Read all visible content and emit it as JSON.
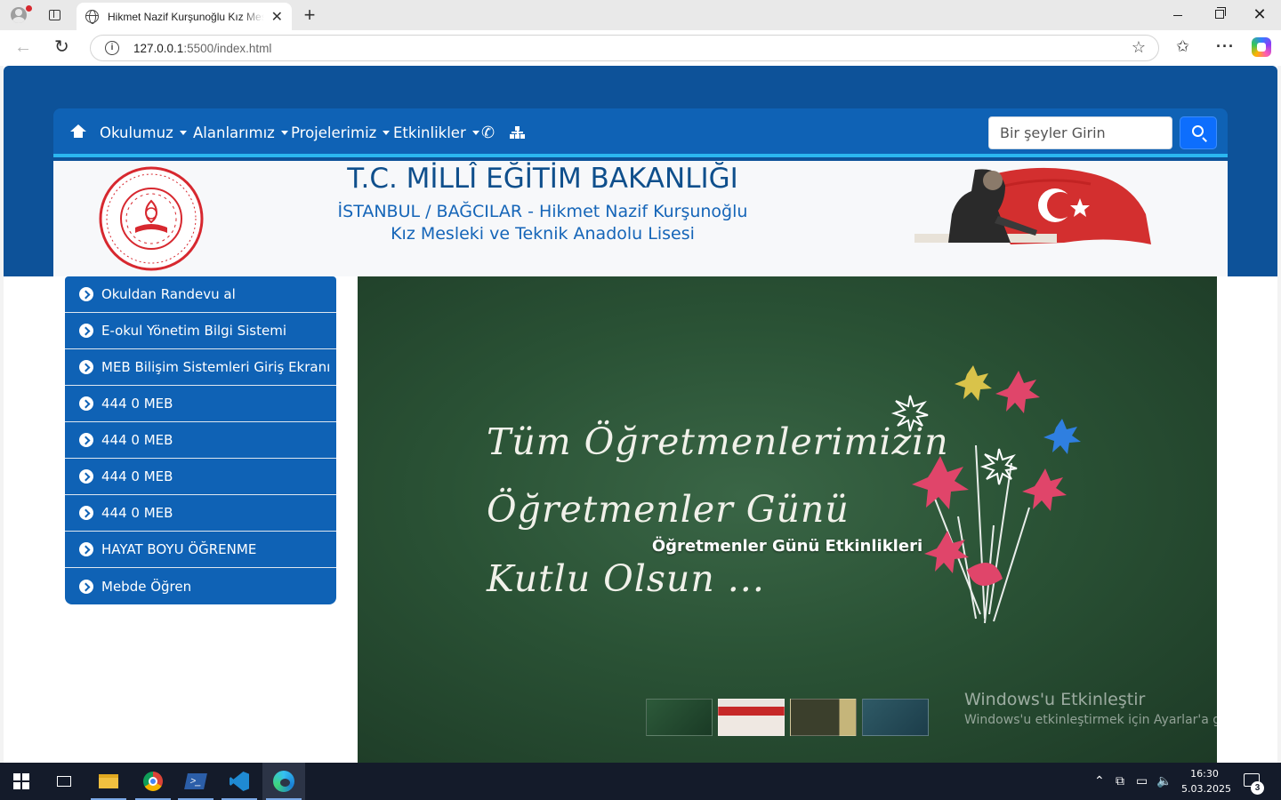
{
  "browser": {
    "tab_title": "Hikmet Nazif Kurşunoğlu Kız Mesleki ve Teknik Anadolu Lisesi",
    "tab_close": "✕",
    "new_tab": "+",
    "url_host": "127.0.0.1",
    "url_rest": ":5500/index.html"
  },
  "nav": {
    "items": [
      {
        "label": "Okulumuz"
      },
      {
        "label": "Alanlarımız"
      },
      {
        "label": "Projelerimiz"
      },
      {
        "label": "Etkinlikler"
      }
    ],
    "search_placeholder": "Bir şeyler Girin"
  },
  "header": {
    "title": "T.C. MİLLÎ EĞİTİM BAKANLIĞI",
    "subtitle_line1": "İSTANBUL / BAĞCILAR - Hikmet Nazif Kurşunoğlu",
    "subtitle_line2": "Kız Mesleki ve Teknik Anadolu Lisesi",
    "seal_text": "TÜRKİYE CUMHURİYETİ MİLLÎ EĞİTİM BAKANLIĞI"
  },
  "sidebar": {
    "items": [
      {
        "label": "Okuldan Randevu al"
      },
      {
        "label": "E-okul Yönetim Bilgi Sistemi"
      },
      {
        "label": "MEB Bilişim Sistemleri Giriş Ekranı"
      },
      {
        "label": "444 0 MEB"
      },
      {
        "label": "444 0 MEB"
      },
      {
        "label": "444 0 MEB"
      },
      {
        "label": "444 0 MEB"
      },
      {
        "label": "HAYAT BOYU ÖĞRENME"
      },
      {
        "label": "Mebde Öğren"
      }
    ]
  },
  "carousel": {
    "chalk_line1": "Tüm Öğretmenlerimizin",
    "chalk_line2": "Öğretmenler Günü",
    "chalk_line3": "Kutlu Olsun ...",
    "caption": "Öğretmenler Günü Etkinlikleri"
  },
  "watermark": {
    "line1": "Windows'u Etkinleştir",
    "line2": "Windows'u etkinleştirmek için Ayarlar'a gidin."
  },
  "taskbar": {
    "time": "16:30",
    "date": "5.03.2025",
    "notification_count": "3"
  },
  "colors": {
    "brand_blue": "#0f62b5",
    "band_blue": "#0d5299",
    "accent_cyan": "#2bb7f0",
    "seal_red": "#d7282f"
  }
}
